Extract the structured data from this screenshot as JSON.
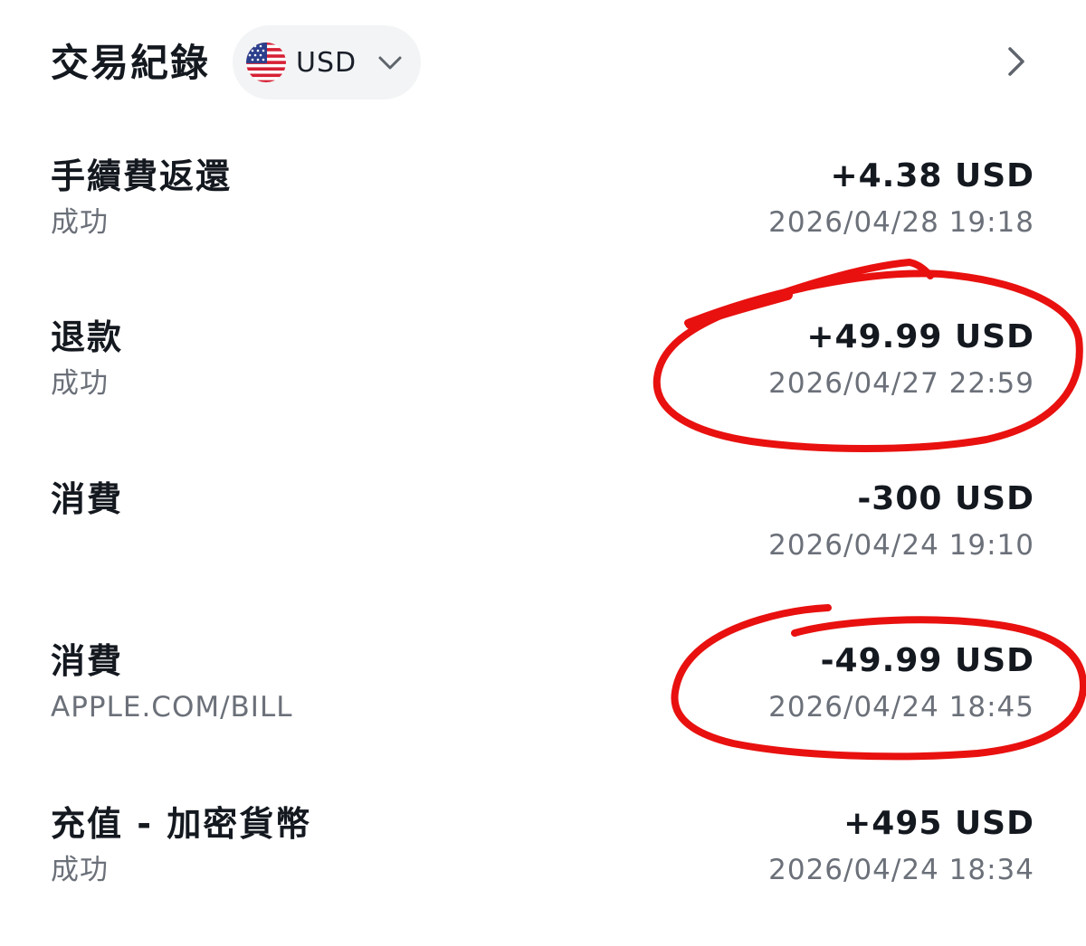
{
  "header": {
    "title": "交易紀錄",
    "currency": "USD",
    "flag_icon": "us-flag-icon",
    "dropdown_icon": "chevron-down-icon",
    "nav_icon": "chevron-right-icon"
  },
  "transactions": [
    {
      "title": "手續費返還",
      "subtitle": "成功",
      "amount": "+4.38 USD",
      "datetime": "2026/04/28 19:18"
    },
    {
      "title": "退款",
      "subtitle": "成功",
      "amount": "+49.99 USD",
      "datetime": "2026/04/27 22:59"
    },
    {
      "title": "消費",
      "subtitle": "",
      "amount": "-300 USD",
      "datetime": "2026/04/24 19:10"
    },
    {
      "title": "消費",
      "subtitle": "APPLE.COM/BILL",
      "amount": "-49.99 USD",
      "datetime": "2026/04/24 18:45"
    },
    {
      "title": "充值 - 加密貨幣",
      "subtitle": "成功",
      "amount": "+495 USD",
      "datetime": "2026/04/24 18:34"
    }
  ],
  "annotations": {
    "circle_color": "#e8110f",
    "circled_transactions": [
      1,
      3
    ]
  }
}
